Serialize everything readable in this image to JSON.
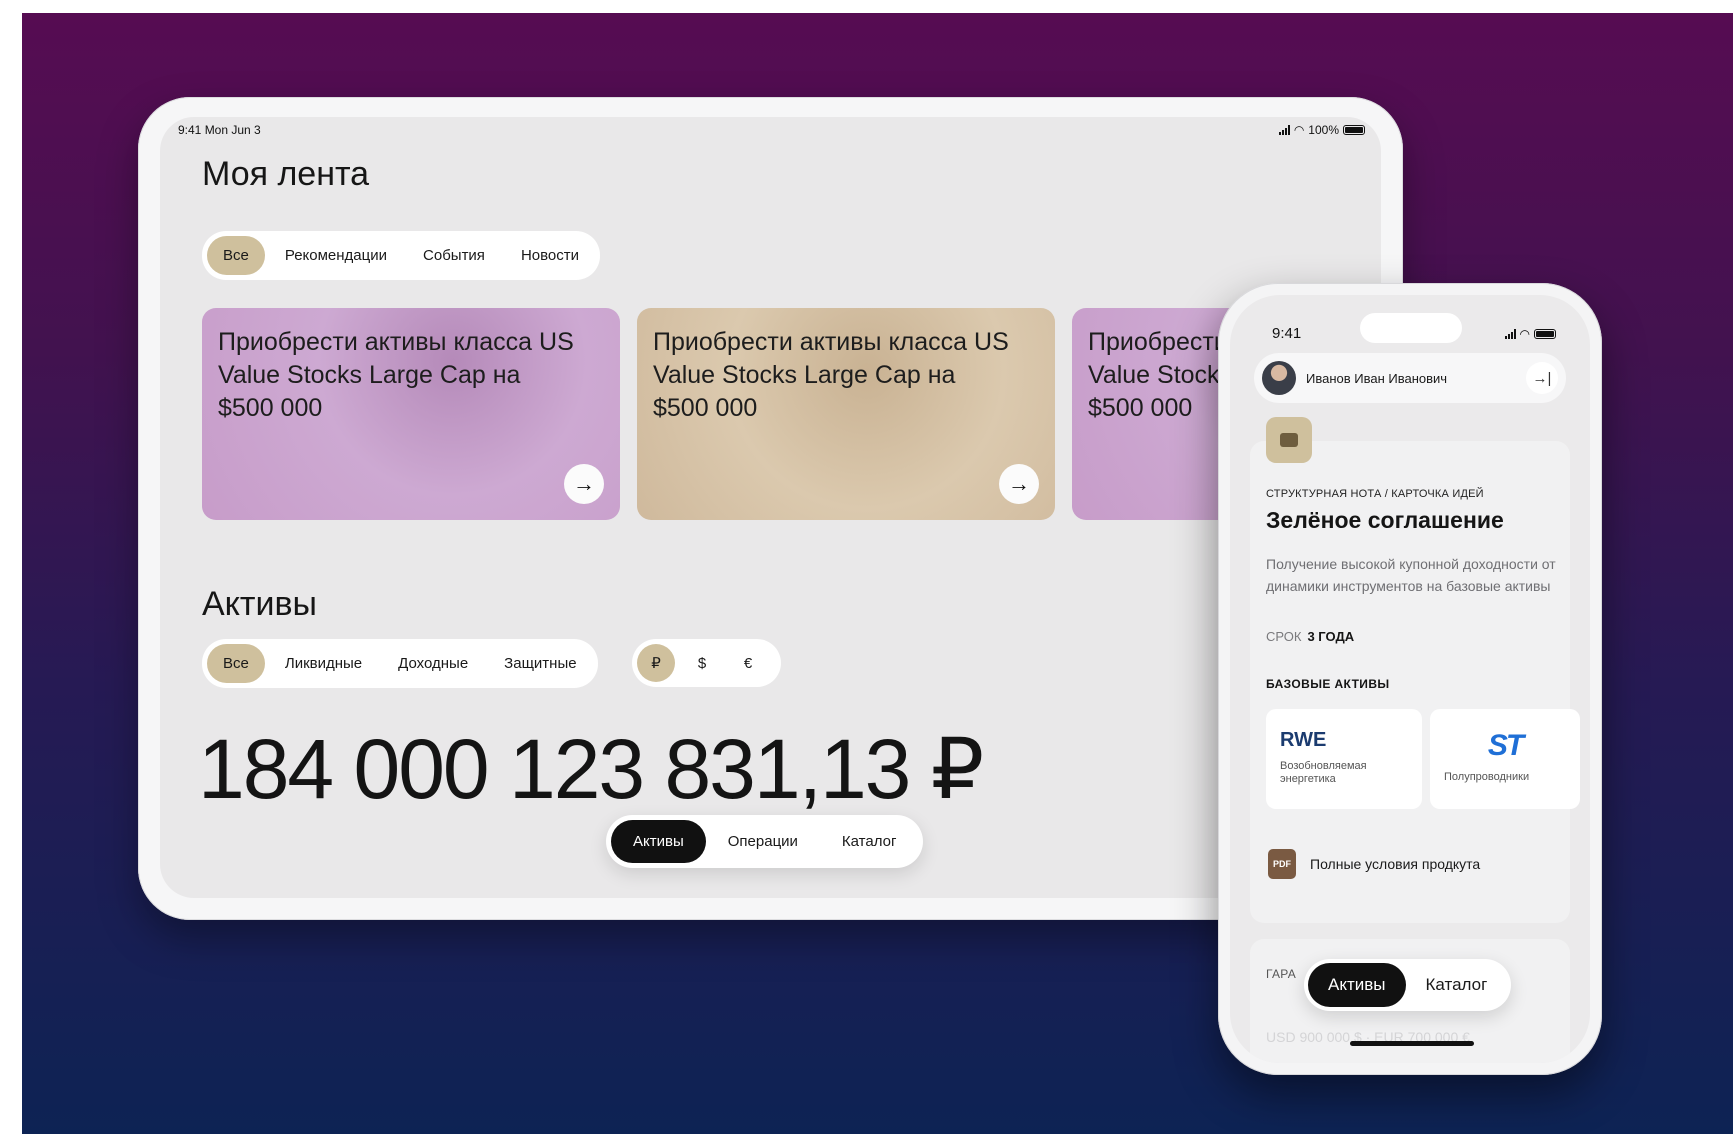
{
  "tablet": {
    "status": {
      "time": "9:41  Mon Jun 3",
      "battery": "100%"
    },
    "feed": {
      "title": "Моя лента",
      "filters": [
        "Все",
        "Рекомендации",
        "События",
        "Новости"
      ],
      "cards": [
        {
          "text": "Приобрести активы класса US Value Stocks Large Cap на $500 000"
        },
        {
          "text": "Приобрести активы класса US Value Stocks Large Cap на $500 000"
        },
        {
          "text": "Приобрести активы класса US Value Stocks Large Cap на $500 000"
        }
      ]
    },
    "assets": {
      "title": "Активы",
      "filters": [
        "Все",
        "Ликвидные",
        "Доходные",
        "Защитные"
      ],
      "currencies": [
        "₽",
        "$",
        "€"
      ],
      "total": "184 000 123 831,13 ₽"
    },
    "tabs": [
      "Активы",
      "Операции",
      "Каталог"
    ]
  },
  "phone": {
    "status": {
      "time": "9:41"
    },
    "user": {
      "name": "Иванов Иван Иванович"
    },
    "product": {
      "kicker": "СТРУКТУРНАЯ НОТА / КАРТОЧКА ИДЕЙ",
      "title": "Зелёное соглашение",
      "description": "Получение высокой купонной доходности от динамики инструментов на базовые активы",
      "term_label": "СРОК",
      "term_value": "3 ГОДА",
      "base_title": "БАЗОВЫЕ АКТИВЫ",
      "base_assets": [
        {
          "logo": "RWE",
          "label": "Возобновляемая энергетика"
        },
        {
          "logo": "ST",
          "label": "Полупроводники"
        }
      ],
      "pdf_badge": "PDF",
      "pdf_link": "Полные условия продкута"
    },
    "next_card": {
      "kicker": "ГАРА",
      "faint": "USD 900 000 $ · EUR 700 000 €"
    },
    "tabs": [
      "Активы",
      "Каталог"
    ]
  }
}
